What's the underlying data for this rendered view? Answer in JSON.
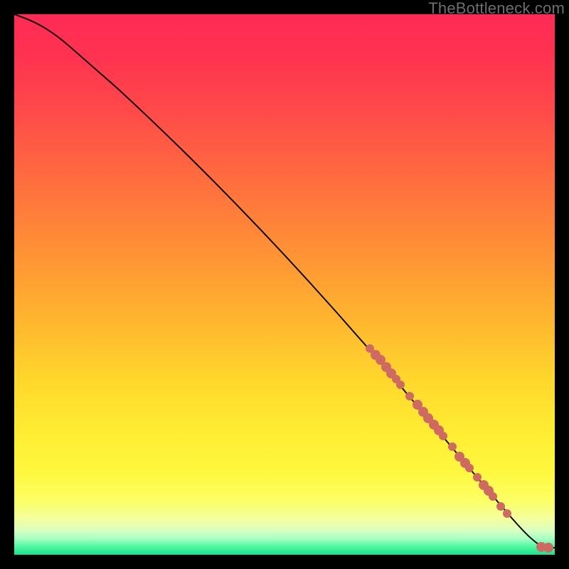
{
  "watermark": "TheBottleneck.com",
  "gradient_stops": [
    {
      "offset": 0.0,
      "color": "#ff2a55"
    },
    {
      "offset": 0.08,
      "color": "#ff3350"
    },
    {
      "offset": 0.18,
      "color": "#ff4a49"
    },
    {
      "offset": 0.3,
      "color": "#ff6b3f"
    },
    {
      "offset": 0.42,
      "color": "#ff8c36"
    },
    {
      "offset": 0.55,
      "color": "#ffb12f"
    },
    {
      "offset": 0.68,
      "color": "#ffd82c"
    },
    {
      "offset": 0.78,
      "color": "#ffee33"
    },
    {
      "offset": 0.85,
      "color": "#fef83f"
    },
    {
      "offset": 0.9,
      "color": "#fcff66"
    },
    {
      "offset": 0.935,
      "color": "#f3ffa0"
    },
    {
      "offset": 0.955,
      "color": "#d9ffc0"
    },
    {
      "offset": 0.97,
      "color": "#a8ffc4"
    },
    {
      "offset": 0.985,
      "color": "#50f7a0"
    },
    {
      "offset": 1.0,
      "color": "#18e28e"
    }
  ],
  "chart_data": {
    "type": "line",
    "title": "",
    "xlabel": "",
    "ylabel": "",
    "xlim": [
      0,
      100
    ],
    "ylim": [
      0,
      100
    ],
    "series": [
      {
        "name": "curve",
        "x": [
          0,
          4,
          8,
          12,
          16,
          20,
          30,
          40,
          50,
          60,
          70,
          80,
          88,
          94,
          97,
          98.5,
          100
        ],
        "y": [
          100,
          98.5,
          96,
          92.5,
          89,
          85.5,
          76,
          66,
          55.5,
          44.5,
          33,
          21,
          11.5,
          4.5,
          1.8,
          1.3,
          1.3
        ]
      }
    ],
    "points": [
      {
        "x": 65.8,
        "y": 38.2,
        "r": 6
      },
      {
        "x": 66.8,
        "y": 37.0,
        "r": 7
      },
      {
        "x": 67.8,
        "y": 36.0,
        "r": 7
      },
      {
        "x": 68.8,
        "y": 34.7,
        "r": 7
      },
      {
        "x": 69.8,
        "y": 33.5,
        "r": 7
      },
      {
        "x": 70.6,
        "y": 32.5,
        "r": 6
      },
      {
        "x": 71.5,
        "y": 31.5,
        "r": 6
      },
      {
        "x": 73.2,
        "y": 29.3,
        "r": 6
      },
      {
        "x": 74.6,
        "y": 27.7,
        "r": 7
      },
      {
        "x": 75.6,
        "y": 26.5,
        "r": 7
      },
      {
        "x": 76.6,
        "y": 25.3,
        "r": 7
      },
      {
        "x": 77.6,
        "y": 24.1,
        "r": 7
      },
      {
        "x": 78.6,
        "y": 23.0,
        "r": 7
      },
      {
        "x": 79.4,
        "y": 22.0,
        "r": 6
      },
      {
        "x": 81.0,
        "y": 20.0,
        "r": 6
      },
      {
        "x": 82.4,
        "y": 18.2,
        "r": 7
      },
      {
        "x": 83.4,
        "y": 17.0,
        "r": 7
      },
      {
        "x": 84.2,
        "y": 16.0,
        "r": 6
      },
      {
        "x": 85.6,
        "y": 14.3,
        "r": 6
      },
      {
        "x": 86.8,
        "y": 12.9,
        "r": 7
      },
      {
        "x": 87.8,
        "y": 11.8,
        "r": 7
      },
      {
        "x": 88.6,
        "y": 10.8,
        "r": 6
      },
      {
        "x": 90.0,
        "y": 9.0,
        "r": 6
      },
      {
        "x": 91.2,
        "y": 7.6,
        "r": 6
      },
      {
        "x": 97.5,
        "y": 1.5,
        "r": 7
      },
      {
        "x": 98.8,
        "y": 1.3,
        "r": 7
      }
    ]
  }
}
